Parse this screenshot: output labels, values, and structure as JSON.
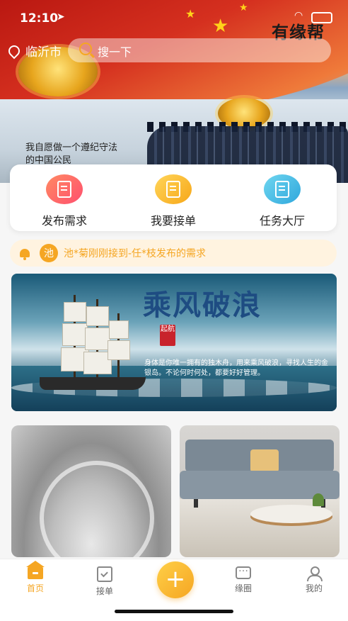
{
  "status_bar": {
    "time": "12:10"
  },
  "brand": "有缘帮",
  "location": {
    "city": "临沂市"
  },
  "search": {
    "placeholder": "搜一下"
  },
  "banner": {
    "slogan": "我自愿做一个遵纪守法的中国公民"
  },
  "quick_actions": [
    {
      "label": "发布需求",
      "icon": "edit-doc-icon"
    },
    {
      "label": "我要接单",
      "icon": "doc-check-icon"
    },
    {
      "label": "任务大厅",
      "icon": "task-list-icon"
    }
  ],
  "notice": {
    "avatar_char": "池",
    "text": "池*菊刚刚接到-任*枝发布的需求"
  },
  "poster": {
    "title": "乘风破浪",
    "seal": "起航",
    "copy": "身体是你唯一拥有的独木舟，用来乘风破浪，寻找人生的金银岛。不论何时何处，都要好好管理。"
  },
  "tabbar": [
    {
      "label": "首页",
      "icon": "home-icon",
      "active": true
    },
    {
      "label": "接单",
      "icon": "order-icon",
      "active": false
    },
    {
      "label": "缘圈",
      "icon": "chat-icon",
      "active": false
    },
    {
      "label": "我的",
      "icon": "user-icon",
      "active": false
    }
  ],
  "fab": "+",
  "colors": {
    "accent": "#f5a623",
    "banner_red": "#c9231b"
  }
}
